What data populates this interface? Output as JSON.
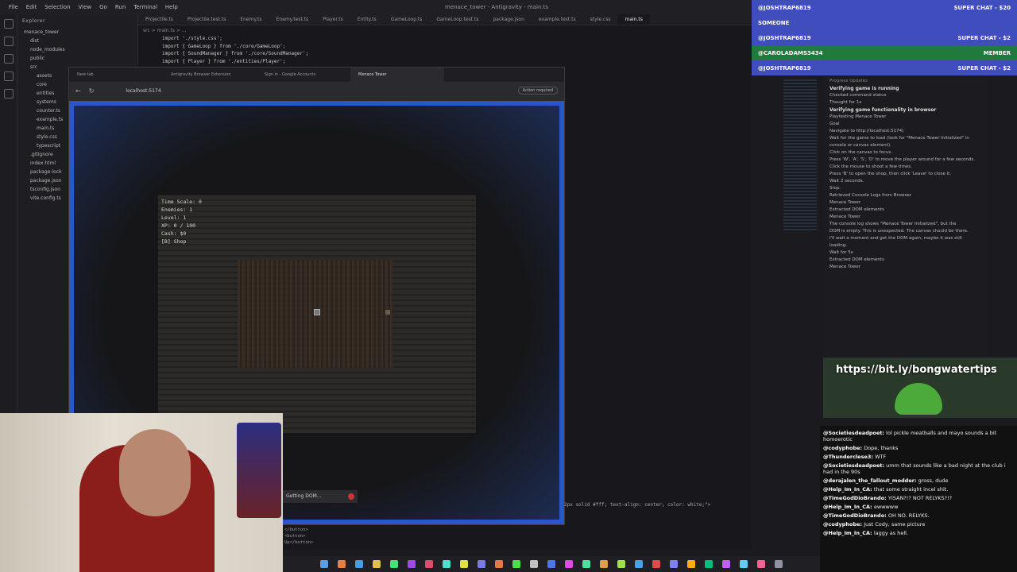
{
  "ide": {
    "title": "menace_tower - Antigravity - main.ts",
    "menu": [
      "File",
      "Edit",
      "Selection",
      "View",
      "Go",
      "Run",
      "Terminal",
      "Help"
    ],
    "explorer_title": "Explorer",
    "tree": [
      {
        "name": "menace_tower",
        "indent": 0
      },
      {
        "name": "dist",
        "indent": 1
      },
      {
        "name": "node_modules",
        "indent": 1
      },
      {
        "name": "public",
        "indent": 1
      },
      {
        "name": "src",
        "indent": 1
      },
      {
        "name": "assets",
        "indent": 2
      },
      {
        "name": "core",
        "indent": 2
      },
      {
        "name": "entities",
        "indent": 2
      },
      {
        "name": "systems",
        "indent": 2
      },
      {
        "name": "counter.ts",
        "indent": 2
      },
      {
        "name": "example.ts",
        "indent": 2
      },
      {
        "name": "main.ts",
        "indent": 2
      },
      {
        "name": "style.css",
        "indent": 2
      },
      {
        "name": "typescript",
        "indent": 2
      },
      {
        "name": ".gitignore",
        "indent": 1
      },
      {
        "name": "index.html",
        "indent": 1
      },
      {
        "name": "package-lock",
        "indent": 1
      },
      {
        "name": "package.json",
        "indent": 1
      },
      {
        "name": "tsconfig.json",
        "indent": 1
      },
      {
        "name": "vite.config.ts",
        "indent": 1
      }
    ],
    "tabs": [
      "Projectile.ts",
      "Projectile.test.ts",
      "Enemy.ts",
      "Enemy.test.ts",
      "Player.ts",
      "Entity.ts",
      "GameLoop.ts",
      "GameLoop.test.ts",
      "package.json",
      "example.test.ts",
      "style.css",
      "main.ts"
    ],
    "breadcrumb": "src > main.ts > ...",
    "code": [
      "import './style.css';",
      "import { GameLoop } from './core/GameLoop';",
      "import { SoundManager } from './core/SoundManager';",
      "import { Player } from './entities/Player';"
    ],
    "trailing_code": "2px solid #fff; text-align: center; color: white;\">",
    "bottom_code": [
      "</button>",
      "<button>",
      "Up</button>"
    ]
  },
  "browser": {
    "tabs": [
      "New tab",
      "Antigravity Browser Extension",
      "Sign in - Google Accounts",
      "Menace Tower"
    ],
    "url": "localhost:5174",
    "status": "Action required",
    "hud": [
      "Time Scale: 0",
      "Enemies: 1",
      "Level: 1",
      "XP: 0 / 100",
      "Cash: $0",
      "[B] Shop"
    ]
  },
  "toast": "Getting DOM...",
  "superchats": [
    {
      "user": "@JOSHTRAP6819",
      "label": "SUPER CHAT - $20",
      "kind": "superchat"
    },
    {
      "user": "SOMEONE",
      "label": "",
      "kind": "superchat"
    },
    {
      "user": "@JOSHTRAP6819",
      "label": "SUPER CHAT - $2",
      "kind": "superchat"
    },
    {
      "user": "@CAROLADAMS3434",
      "label": "MEMBER",
      "kind": "member"
    },
    {
      "user": "@JOSHTRAP6819",
      "label": "SUPER CHAT - $2",
      "kind": "superchat"
    }
  ],
  "agent": {
    "section": "Progress Updates",
    "items": [
      "Verifying game is running",
      "Checked command status",
      "Thought for 1s",
      "Verifying game functionality in browser",
      "Playtesting Menace Tower",
      "Goal",
      "Navigate to http://localhost:5174/.",
      "Wait for the game to load (look for \"Menace Tower Initialized\" in",
      "console or canvas element).",
      "Click on the canvas to focus.",
      "Press 'W', 'A', 'S', 'D' to move the player around for a few seconds.",
      "Click the mouse to shoot a few times.",
      "Press 'B' to open the shop, then click 'Leave' to close it.",
      "Wait 2 seconds.",
      "Stop.",
      "Retrieved Console Logs from Browser",
      "Menace Tower",
      "Extracted DOM elements",
      "Menace Tower",
      "The console log shows \"Menace Tower Initialized\", but the",
      "DOM is empty. This is unexpected. The canvas should be there.",
      "I'll wait a moment and get the DOM again, maybe it was still",
      "loading.",
      "Wait for 5s",
      "Extracted DOM elements",
      "Menace Tower"
    ],
    "expand": "Expand",
    "preview": "Preview"
  },
  "banner": {
    "link": "https://bit.ly/bongwatertips"
  },
  "chat": [
    {
      "user": "@Societiesdeadpoet:",
      "text": "lol pickle meatballs and mayo sounds a bit homoerotic"
    },
    {
      "user": "@codyphobe:",
      "text": "Dope, thanks"
    },
    {
      "user": "@Thunderclese3:",
      "text": "WTF"
    },
    {
      "user": "@Societiesdeadpoet:",
      "text": "umm that sounds like a bad night at the club i had in the 90s"
    },
    {
      "user": "@derajalen_the_fallout_modder:",
      "text": "gross, dude"
    },
    {
      "user": "@Help_Im_In_CA:",
      "text": "that some straight incel shit."
    },
    {
      "user": "@TimeGodDioBrando:",
      "text": "YISAN?!? NOT RELYKS?!?"
    },
    {
      "user": "@Help_Im_In_CA:",
      "text": "ewwwww"
    },
    {
      "user": "@TimeGodDioBrando:",
      "text": "OH NO. RELYKS."
    },
    {
      "user": "@codyphobe:",
      "text": "Just Cody, same picture"
    },
    {
      "user": "@Help_Im_In_CA:",
      "text": "laggy as hell."
    }
  ]
}
